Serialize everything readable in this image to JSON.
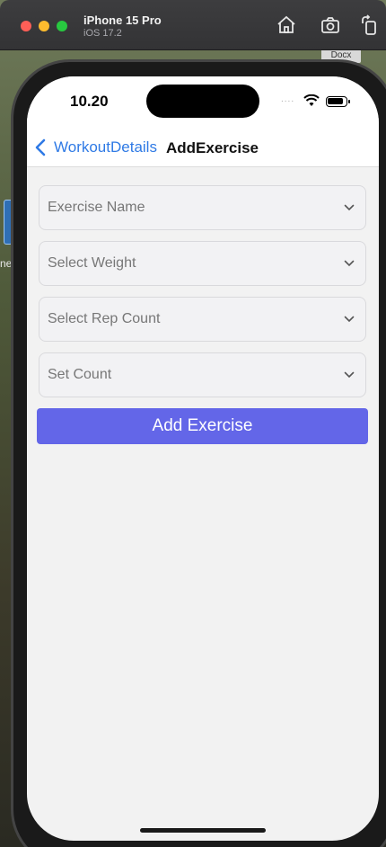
{
  "simulator": {
    "device_name": "iPhone 15 Pro",
    "os_version": "iOS 17.2"
  },
  "desktop": {
    "doc_label": "Docx",
    "side_text": "ne"
  },
  "status_bar": {
    "time": "10.20",
    "signal_dots": "...."
  },
  "nav": {
    "back_label": "WorkoutDetails",
    "title": "AddExercise"
  },
  "form": {
    "fields": [
      {
        "label": "Exercise Name"
      },
      {
        "label": "Select Weight"
      },
      {
        "label": "Select Rep Count"
      },
      {
        "label": "Set Count"
      }
    ],
    "submit_label": "Add Exercise"
  },
  "colors": {
    "accent": "#6366e8",
    "link": "#2f7ae5",
    "background": "#f2f2f2"
  }
}
